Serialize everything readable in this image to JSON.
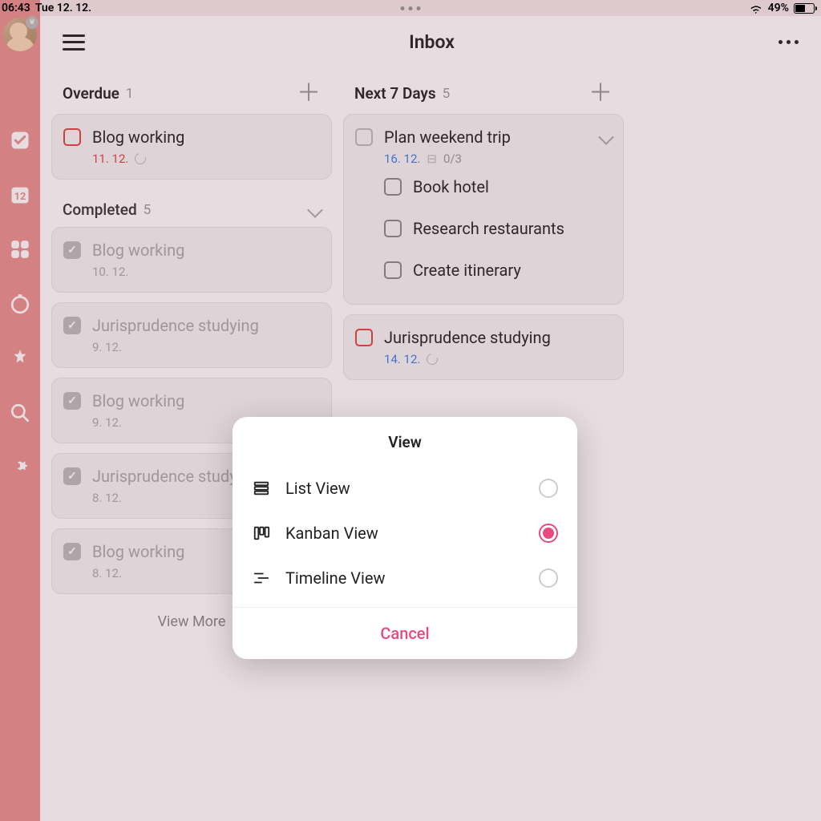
{
  "status": {
    "time": "06:43",
    "date": "Tue 12. 12.",
    "battery_pct": "49%"
  },
  "header": {
    "title": "Inbox"
  },
  "columns": {
    "overdue": {
      "title": "Overdue",
      "count": "1",
      "tasks": [
        {
          "title": "Blog working",
          "date": "11. 12."
        }
      ]
    },
    "next7": {
      "title": "Next 7 Days",
      "count": "5",
      "tasks": [
        {
          "title": "Plan weekend trip",
          "date": "16. 12.",
          "subcount": "0/3",
          "subtasks": [
            {
              "title": "Book hotel"
            },
            {
              "title": "Research restaurants"
            },
            {
              "title": "Create itinerary"
            }
          ]
        },
        {
          "title": "Jurisprudence studying",
          "date": "14. 12."
        }
      ]
    },
    "completed": {
      "title": "Completed",
      "count": "5",
      "tasks": [
        {
          "title": "Blog working",
          "date": "10. 12."
        },
        {
          "title": "Jurisprudence studying",
          "date": "9. 12."
        },
        {
          "title": "Blog working",
          "date": "9. 12."
        },
        {
          "title": "Jurisprudence studying",
          "date": "8. 12."
        },
        {
          "title": "Blog working",
          "date": "8. 12."
        }
      ],
      "view_more": "View More"
    }
  },
  "dialog": {
    "title": "View",
    "options": [
      {
        "label": "List View",
        "selected": false
      },
      {
        "label": "Kanban View",
        "selected": true
      },
      {
        "label": "Timeline View",
        "selected": false
      }
    ],
    "cancel": "Cancel"
  }
}
